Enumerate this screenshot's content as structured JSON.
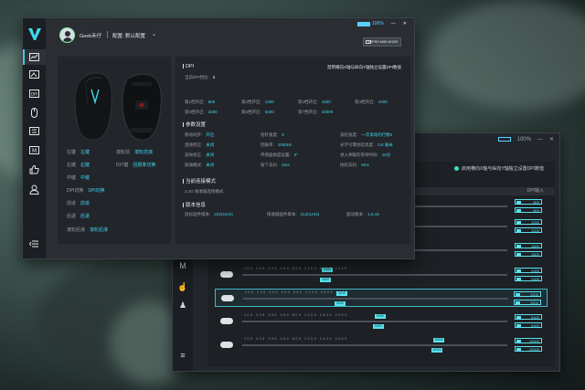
{
  "front_window": {
    "titlebar": {
      "battery_percent": "100%",
      "min_label": "—",
      "close_label": "✕"
    },
    "user": {
      "name": "Geek禾仔",
      "separator": "|",
      "profile": "配置: 默认配置",
      "profile_chevron": "⌄"
    },
    "device_chip": "VGPRO MINI MGDR",
    "sidebar_icons": [
      "logo-icon",
      "performance-icon",
      "lighting-icon",
      "dpi-icon",
      "mouse-icon",
      "macro-icon",
      "keyboard-icon",
      "like-icon",
      "user-icon",
      "collapse-icon"
    ],
    "button_info": [
      {
        "k": "左键",
        "v": "左键"
      },
      {
        "k": "滚轮前",
        "v": "滚轮前滚"
      },
      {
        "k": "右键",
        "v": "右键"
      },
      {
        "k": "DIY键",
        "v": "回报率切换"
      },
      {
        "k": "中键",
        "v": "中键"
      },
      {
        "k": "DPI切换",
        "v": "DPI切换"
      },
      {
        "k": "前进",
        "v": "前进"
      },
      {
        "k": "后退",
        "v": "后退"
      },
      {
        "k": "滚轮后滚",
        "v": "滚轮后滚"
      }
    ],
    "dpi": {
      "title": "DPI",
      "note": "禁用横向X轴与纵向Y轴独立设置DPI数值",
      "current_level": {
        "k": "当前DPI挡位:",
        "v": "5"
      },
      "levels": [
        {
          "k": "第1档开启:",
          "v": "800"
        },
        {
          "k": "第2档开启:",
          "v": "1200"
        },
        {
          "k": "第3档开启:",
          "v": "1600"
        },
        {
          "k": "第4档开启:",
          "v": "2400"
        },
        {
          "k": "第5档开启:",
          "v": "3200"
        },
        {
          "k": "第6档开启:",
          "v": "6400"
        },
        {
          "k": "第7档开启:",
          "v": "10000"
        }
      ]
    },
    "params": {
      "title": "参数设置",
      "items": [
        {
          "k": "移动同步:",
          "v": "开启"
        },
        {
          "k": "指针速度:",
          "v": "6"
        },
        {
          "k": "滚轮速度:",
          "v": "一次滚动的行数3"
        },
        {
          "k": "直线修正:",
          "v": "关闭"
        },
        {
          "k": "回报率:",
          "v": "1000Hz"
        },
        {
          "k": "光学引擎抬起高度:",
          "v": "0.8 毫米"
        },
        {
          "k": "波纹修正:",
          "v": "关闭"
        },
        {
          "k": "传感器角度设置:",
          "v": "0°"
        },
        {
          "k": "进入休眠的等待时间:",
          "v": "10分"
        },
        {
          "k": "玻璃模式:",
          "v": "关闭"
        },
        {
          "k": "按下去抖:",
          "v": "6ms"
        },
        {
          "k": "抬起去抖:",
          "v": "8ms"
        }
      ]
    },
    "connection": {
      "title": "当前连接模式",
      "value": "2.4G 接收器连接模式"
    },
    "version": {
      "title": "版本信息",
      "items": [
        {
          "k": "鼠标固件版本:",
          "v": "222(4444)"
        },
        {
          "k": "接收器固件版本:",
          "v": "213(1244)"
        },
        {
          "k": "驱动版本:",
          "v": "1.6.16"
        }
      ]
    }
  },
  "back_window": {
    "battery_percent": "100%",
    "mode_option": "启用横向X轴与纵向Y轴独立设置DPI数值",
    "column_header": "DPI输入",
    "tick_labels": "100 200 300 400 800 1200 1600 2400",
    "dpi_rows": [
      {
        "x": "800",
        "y": "800",
        "knob_x": "",
        "knob_y": ""
      },
      {
        "x": "1200",
        "y": "1200",
        "knob_x": "",
        "knob_y": ""
      },
      {
        "x": "1600",
        "y": "1600",
        "knob_x": "",
        "knob_y": ""
      },
      {
        "x": "2400",
        "y": "2400",
        "knob_x": "2400",
        "knob_y": "1600"
      },
      {
        "x": "3200",
        "y": "3200",
        "knob_x": "3200",
        "knob_y": "3200"
      },
      {
        "x": "6400",
        "y": "6400",
        "knob_x": "6400",
        "knob_y": "6400"
      },
      {
        "x": "10000",
        "y": "10000",
        "knob_x": "10000",
        "knob_y": "10000"
      }
    ]
  }
}
